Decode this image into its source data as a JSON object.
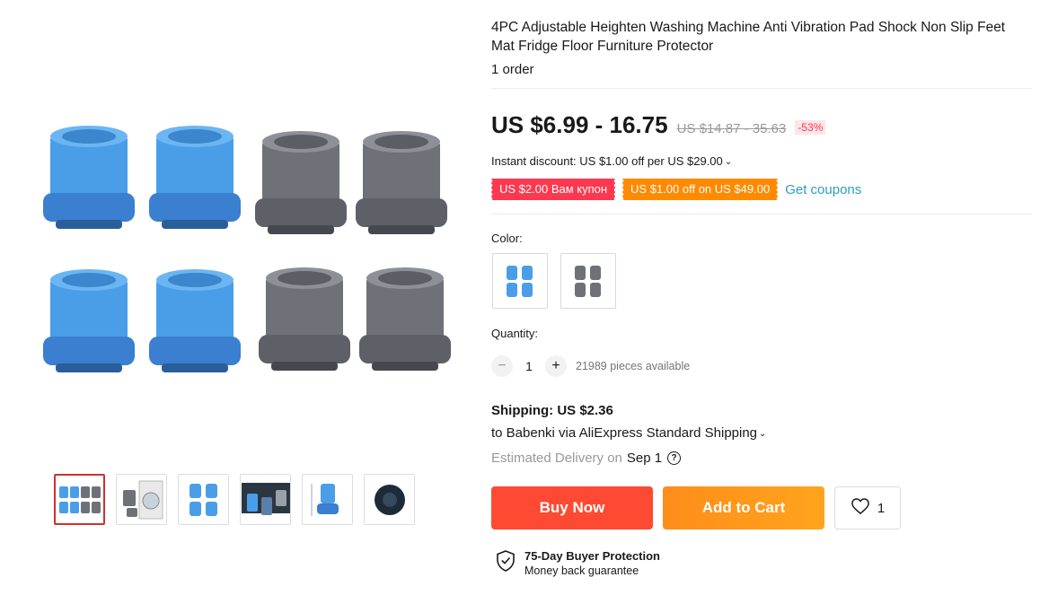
{
  "product": {
    "title": "4PC Adjustable Heighten Washing Machine Anti Vibration Pad Shock Non Slip Feet Mat Fridge Floor Furniture Protector",
    "orders": "1 order"
  },
  "price": {
    "current": "US $6.99 - 16.75",
    "original": "US $14.87 - 35.63",
    "discount": "-53%"
  },
  "instant_discount": "Instant discount: US $1.00 off per US $29.00",
  "coupons": {
    "red": "US $2.00 Вам купон",
    "orange": "US $1.00 off on US $49.00",
    "link": "Get coupons"
  },
  "color": {
    "label": "Color:",
    "options": [
      "blue",
      "gray"
    ]
  },
  "quantity": {
    "label": "Quantity:",
    "minus": "−",
    "value": "1",
    "plus": "+",
    "available": "21989 pieces available"
  },
  "shipping": {
    "title": "Shipping: US $2.36",
    "to": "to Babenki via AliExpress Standard Shipping",
    "delivery_label": "Estimated Delivery on",
    "delivery_date": "Sep 1",
    "help": "?"
  },
  "actions": {
    "buy_now": "Buy Now",
    "add_to_cart": "Add to Cart",
    "wishlist_count": "1"
  },
  "protection": {
    "title": "75-Day Buyer Protection",
    "subtitle": "Money back guarantee"
  },
  "colors": {
    "blue": "#4a9ee8",
    "gray": "#6e7178",
    "accent_red": "#fd384f",
    "accent_orange": "#ff8a00"
  }
}
